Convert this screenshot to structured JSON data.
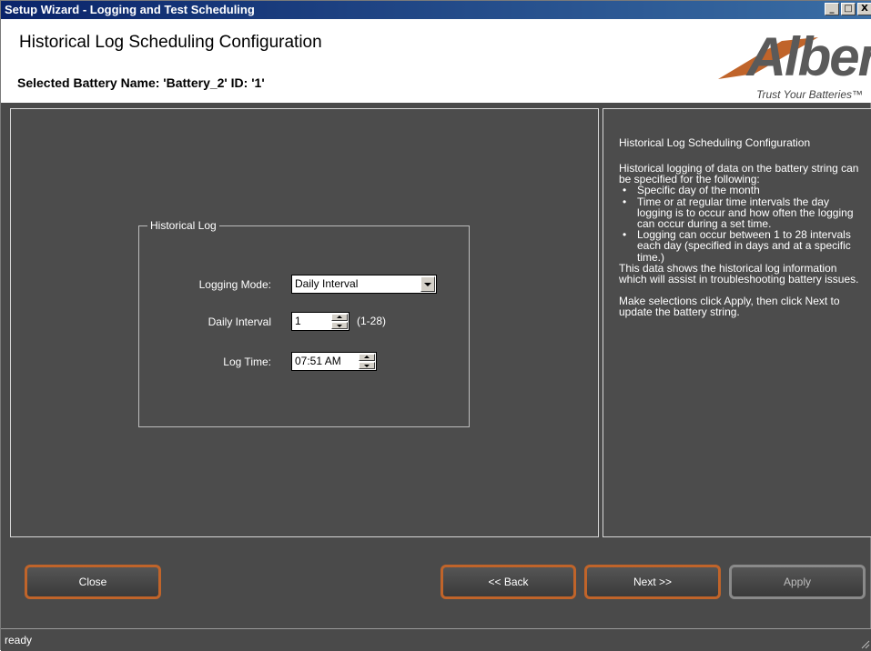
{
  "window": {
    "title": "Setup Wizard - Logging and Test Scheduling",
    "minimize": "_",
    "maximize": "□",
    "close": "X"
  },
  "header": {
    "title": "Historical Log Scheduling Configuration",
    "selected_battery": "Selected Battery Name: 'Battery_2' ID: '1'",
    "logo_text": "Alber",
    "logo_tagline": "Trust Your Batteries™"
  },
  "group": {
    "legend": "Historical Log",
    "logging_mode_label": "Logging Mode:",
    "logging_mode_value": "Daily Interval",
    "daily_interval_label": "Daily Interval",
    "daily_interval_value": "1",
    "daily_interval_range": "(1-28)",
    "log_time_label": "Log Time:",
    "log_time_value": "07:51 AM"
  },
  "help": {
    "title": "Historical Log Scheduling Configuration",
    "intro": "Historical logging of data on the battery string can be specified for the following:",
    "bullets": [
      "Specific day of the month",
      "Time or at regular time intervals the day logging is to occur and how often the logging can occur during a set time.",
      "Logging can occur between 1 to 28 intervals each day (specified in days and at a specific time.)"
    ],
    "p2": "This data shows the historical log information which will assist in troubleshooting battery issues.",
    "p3": "Make selections click Apply, then click Next to update the battery string."
  },
  "buttons": {
    "close": "Close",
    "back": "<< Back",
    "next": "Next >>",
    "apply": "Apply"
  },
  "status": {
    "text": "ready"
  },
  "colors": {
    "panel": "#4c4c4c",
    "button_border": "#c0642a",
    "title_bar": "#0a246a"
  }
}
